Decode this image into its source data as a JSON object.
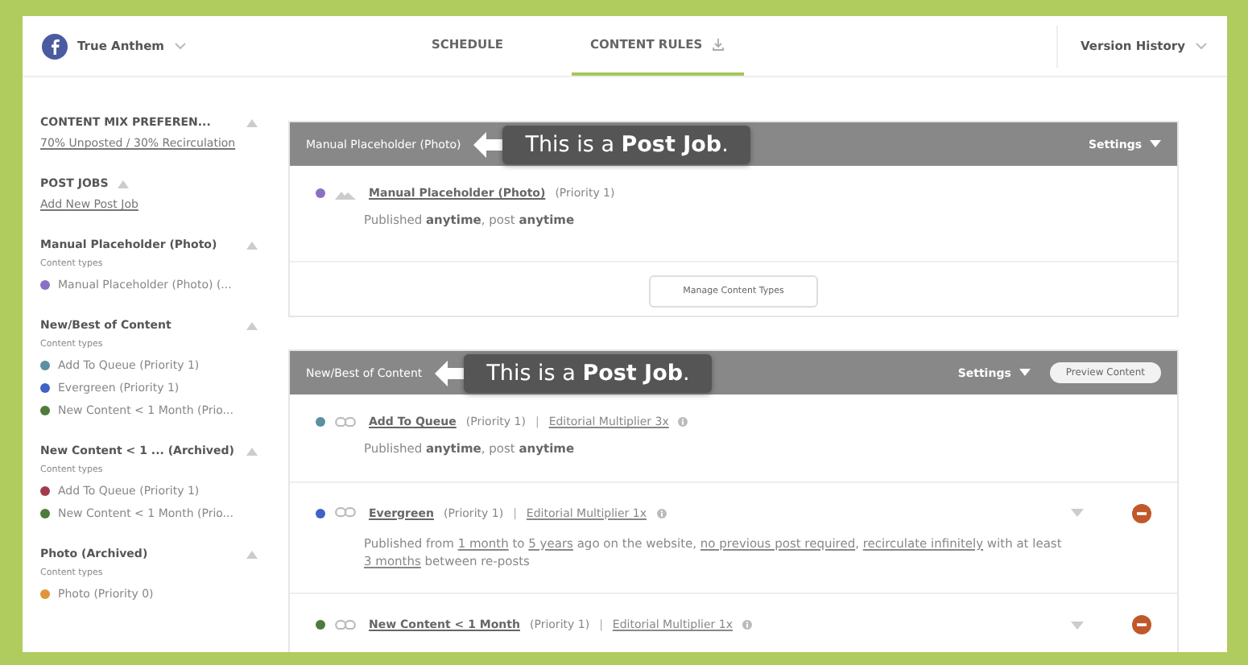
{
  "header": {
    "account": "True Anthem",
    "tabs": [
      {
        "label": "SCHEDULE",
        "selected": false,
        "icon": false
      },
      {
        "label": "CONTENT RULES",
        "selected": true,
        "icon": true
      }
    ],
    "version_history": "Version History"
  },
  "sidebar": [
    {
      "title": "CONTENT MIX PREFEREN...",
      "kind": "heading",
      "link": "70% Unposted / 30% Recirculation"
    },
    {
      "title": "POST JOBS",
      "kind": "heading",
      "link": "Add New Post Job"
    },
    {
      "title": "Manual Placeholder (Photo)",
      "kind": "job",
      "subtitle": "Content types",
      "items": [
        {
          "label": "Manual Placeholder (Photo) (...",
          "color": "#8a6fc4"
        }
      ]
    },
    {
      "title": "New/Best of Content",
      "kind": "job",
      "subtitle": "Content types",
      "items": [
        {
          "label": "Add To Queue (Priority 1)",
          "color": "#5b8fa3"
        },
        {
          "label": "Evergreen (Priority 1)",
          "color": "#3f63c4"
        },
        {
          "label": "New Content < 1 Month (Prio...",
          "color": "#4e7b3c"
        }
      ]
    },
    {
      "title": "New Content < 1 ...  (Archived)",
      "kind": "job",
      "subtitle": "Content types",
      "items": [
        {
          "label": "Add To Queue (Priority 1)",
          "color": "#a33a4a"
        },
        {
          "label": "New Content < 1 Month (Prio...",
          "color": "#4e7b3c"
        }
      ]
    },
    {
      "title": "Photo (Archived)",
      "kind": "job",
      "subtitle": "Content types",
      "items": [
        {
          "label": "Photo (Priority 0)",
          "color": "#e0953a"
        }
      ]
    }
  ],
  "cards": [
    {
      "title": "Manual Placeholder (Photo)",
      "callout": "This is a **Post Job**.",
      "settings": "Settings",
      "rows": [
        {
          "color": "#8a6fc4",
          "kind": "photo",
          "title": "Manual Placeholder (Photo)",
          "priority": "(Priority 1)",
          "removable": false,
          "description": [
            {
              "kind": "rich",
              "text": "Published **anytime**, post **anytime**"
            }
          ]
        }
      ],
      "footer_button": "Manage Content Types"
    },
    {
      "title": "New/Best of Content",
      "callout": "This is a **Post Job**.",
      "settings": "Settings",
      "preview_button": "Preview Content",
      "rows": [
        {
          "color": "#5b8fa3",
          "kind": "link",
          "title": "Add To Queue",
          "priority": "(Priority 1)",
          "separator": "|",
          "multiplier": "Editorial Multiplier 3x",
          "removable": false,
          "description": [
            {
              "kind": "rich",
              "text": "Published **anytime**, post **anytime**"
            }
          ]
        },
        {
          "color": "#3f63c4",
          "kind": "link",
          "title": "Evergreen",
          "priority": "(Priority 1)",
          "separator": "|",
          "multiplier": "Editorial Multiplier 1x",
          "removable": true,
          "description": [
            {
              "kind": "plain",
              "text": "Published from "
            },
            {
              "kind": "link",
              "text": "1 month"
            },
            {
              "kind": "plain",
              "text": " to "
            },
            {
              "kind": "link",
              "text": "5 years"
            },
            {
              "kind": "plain",
              "text": " ago on the website, "
            },
            {
              "kind": "link",
              "text": "no previous post required"
            },
            {
              "kind": "plain",
              "text": ", "
            },
            {
              "kind": "link",
              "text": "recirculate infinitely"
            },
            {
              "kind": "plain",
              "text": " with at least "
            },
            {
              "kind": "link",
              "text": "3 months"
            },
            {
              "kind": "plain",
              "text": " between re-posts"
            }
          ]
        },
        {
          "color": "#4e7b3c",
          "kind": "link",
          "title": "New Content < 1 Month",
          "priority": "(Priority 1)",
          "separator": "|",
          "multiplier": "Editorial Multiplier 1x",
          "removable": true
        }
      ]
    }
  ]
}
